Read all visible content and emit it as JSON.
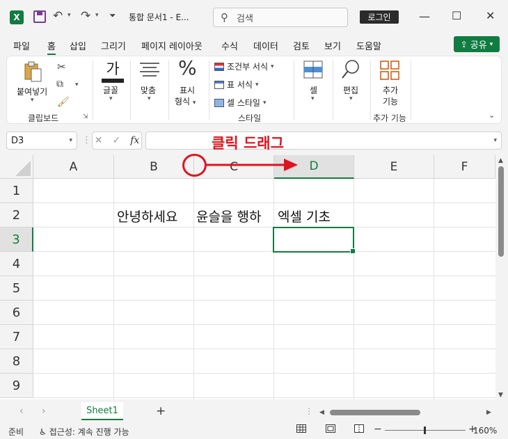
{
  "titlebar": {
    "app_icon": "X",
    "doc_title": "통합 문서1  -  E...",
    "search_placeholder": "검색",
    "login_label": "로그인",
    "minimize": "—",
    "maximize": "☐",
    "close": "✕"
  },
  "menu": {
    "tabs": [
      "파일",
      "홈",
      "삽입",
      "그리기",
      "페이지 레이아웃",
      "수식",
      "데이터",
      "검토",
      "보기",
      "도움말"
    ],
    "active": "홈",
    "share_label": "공유"
  },
  "ribbon": {
    "paste_label": "붙여넣기",
    "clipboard_group": "클립보드",
    "font_label": "글꼴",
    "font_glyph": "가",
    "align_label": "맞춤",
    "number_label_1": "표시",
    "number_label_2": "형식",
    "number_glyph": "%",
    "conditional_format": "조건부 서식",
    "table_format": "표 서식",
    "cell_style": "셀 스타일",
    "style_group": "스타일",
    "cells_label": "셀",
    "edit_label": "편집",
    "addin_label_1": "추가",
    "addin_label_2": "기능",
    "addin_group": "추가 기능"
  },
  "formula_bar": {
    "name_box": "D3",
    "fx": "fx",
    "formula_value": ""
  },
  "grid": {
    "columns": [
      "A",
      "B",
      "C",
      "D",
      "E",
      "F"
    ],
    "rows": [
      "1",
      "2",
      "3",
      "4",
      "5",
      "6",
      "7",
      "8",
      "9"
    ],
    "selected_column": "D",
    "selected_row": "3",
    "cells": {
      "B2": "안녕하세요",
      "C2": "윤슬을 행하",
      "D2": "엑셀 기초"
    }
  },
  "annotation": {
    "label": "클릭 드래그",
    "color": "#e0141e"
  },
  "sheets": {
    "tabs": [
      "Sheet1"
    ],
    "add": "+"
  },
  "status": {
    "ready": "준비",
    "accessibility": "접근성: 계속 진행 가능",
    "zoom_minus": "−",
    "zoom_plus": "+",
    "zoom_level": "160%"
  },
  "colors": {
    "accent": "#107c41",
    "annotation": "#e0141e"
  }
}
